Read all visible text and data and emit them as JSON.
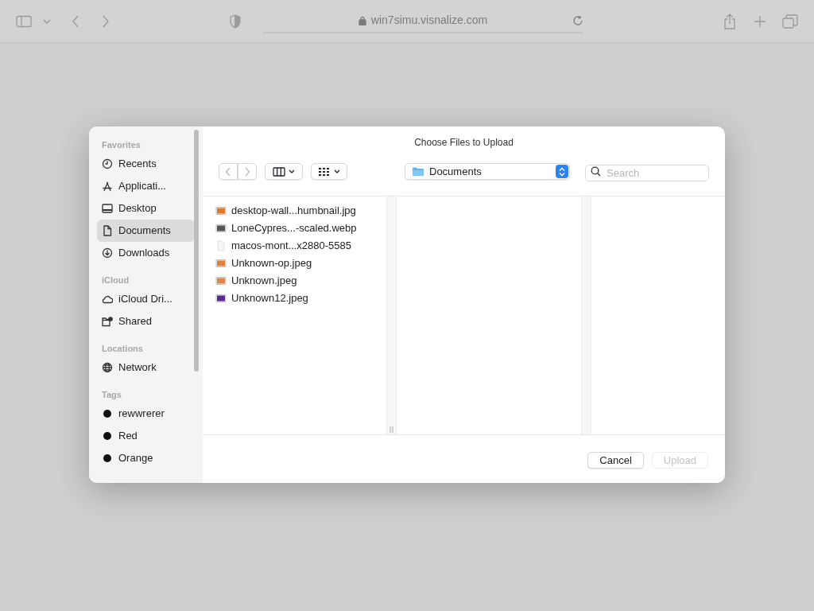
{
  "browser": {
    "address": "win7simu.visnalize.com"
  },
  "dialog": {
    "title": "Choose Files to Upload",
    "sidebar": [
      {
        "heading": "Favorites",
        "items": [
          {
            "label": "Recents",
            "kind": "place",
            "selected": false
          },
          {
            "label": "Applicati...",
            "kind": "place",
            "selected": false
          },
          {
            "label": "Desktop",
            "kind": "place",
            "selected": false
          },
          {
            "label": "Documents",
            "kind": "place",
            "selected": true
          },
          {
            "label": "Downloads",
            "kind": "place",
            "selected": false
          }
        ]
      },
      {
        "heading": "iCloud",
        "items": [
          {
            "label": "iCloud Dri...",
            "kind": "place",
            "selected": false
          },
          {
            "label": "Shared",
            "kind": "place",
            "selected": false
          }
        ]
      },
      {
        "heading": "Locations",
        "items": [
          {
            "label": "Network",
            "kind": "place",
            "selected": false
          }
        ]
      },
      {
        "heading": "Tags",
        "items": [
          {
            "label": "rewwrerer",
            "kind": "tag",
            "color": "#111111",
            "selected": false
          },
          {
            "label": "Red",
            "kind": "tag",
            "color": "#111111",
            "selected": false
          },
          {
            "label": "Orange",
            "kind": "tag",
            "color": "#111111",
            "selected": false
          }
        ]
      }
    ],
    "location": "Documents",
    "search": {
      "placeholder": "Search"
    },
    "files": [
      {
        "name": "desktop-wall...humbnail.jpg",
        "kind": "image",
        "color": "#e07a2e"
      },
      {
        "name": "LoneCypres...-scaled.webp",
        "kind": "image",
        "color": "#555555"
      },
      {
        "name": "macos-mont...x2880-5585",
        "kind": "blank"
      },
      {
        "name": "Unknown-op.jpeg",
        "kind": "image",
        "color": "#e0803a"
      },
      {
        "name": "Unknown.jpeg",
        "kind": "image",
        "color": "#d9874a"
      },
      {
        "name": "Unknown12.jpeg",
        "kind": "image",
        "color": "#5a2a8a"
      }
    ],
    "buttons": [
      {
        "label": "Cancel",
        "disabled": false
      },
      {
        "label": "Upload",
        "disabled": true
      }
    ]
  }
}
